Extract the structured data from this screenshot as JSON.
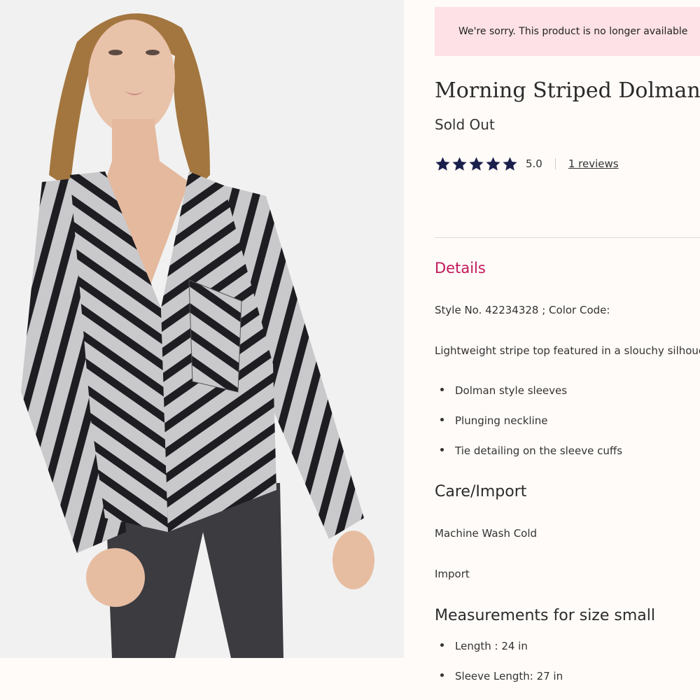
{
  "notice": "We're sorry. This product is no longer available",
  "product": {
    "title": "Morning Striped Dolman",
    "status": "Sold Out",
    "rating": "5.0",
    "star_count": 5,
    "reviews_link": "1 reviews"
  },
  "details": {
    "heading": "Details",
    "style_line": "Style No. 42234328 ; Color Code:",
    "description": "Lightweight stripe top featured in a slouchy silhouette.",
    "bullets": [
      "Dolman style sleeves",
      "Plunging neckline",
      "Tie detailing on the sleeve cuffs"
    ]
  },
  "care": {
    "heading": "Care/Import",
    "wash": "Machine Wash Cold",
    "origin": "Import"
  },
  "measurements": {
    "heading": "Measurements for size small",
    "items": [
      "Length : 24 in",
      "Sleeve Length: 27 in"
    ]
  },
  "colors": {
    "accent": "#c2185b",
    "notice_bg": "#fde1e6",
    "star": "#1b1f4b",
    "page_bg": "#fffbf8"
  },
  "icons": {
    "star": "star-icon"
  }
}
